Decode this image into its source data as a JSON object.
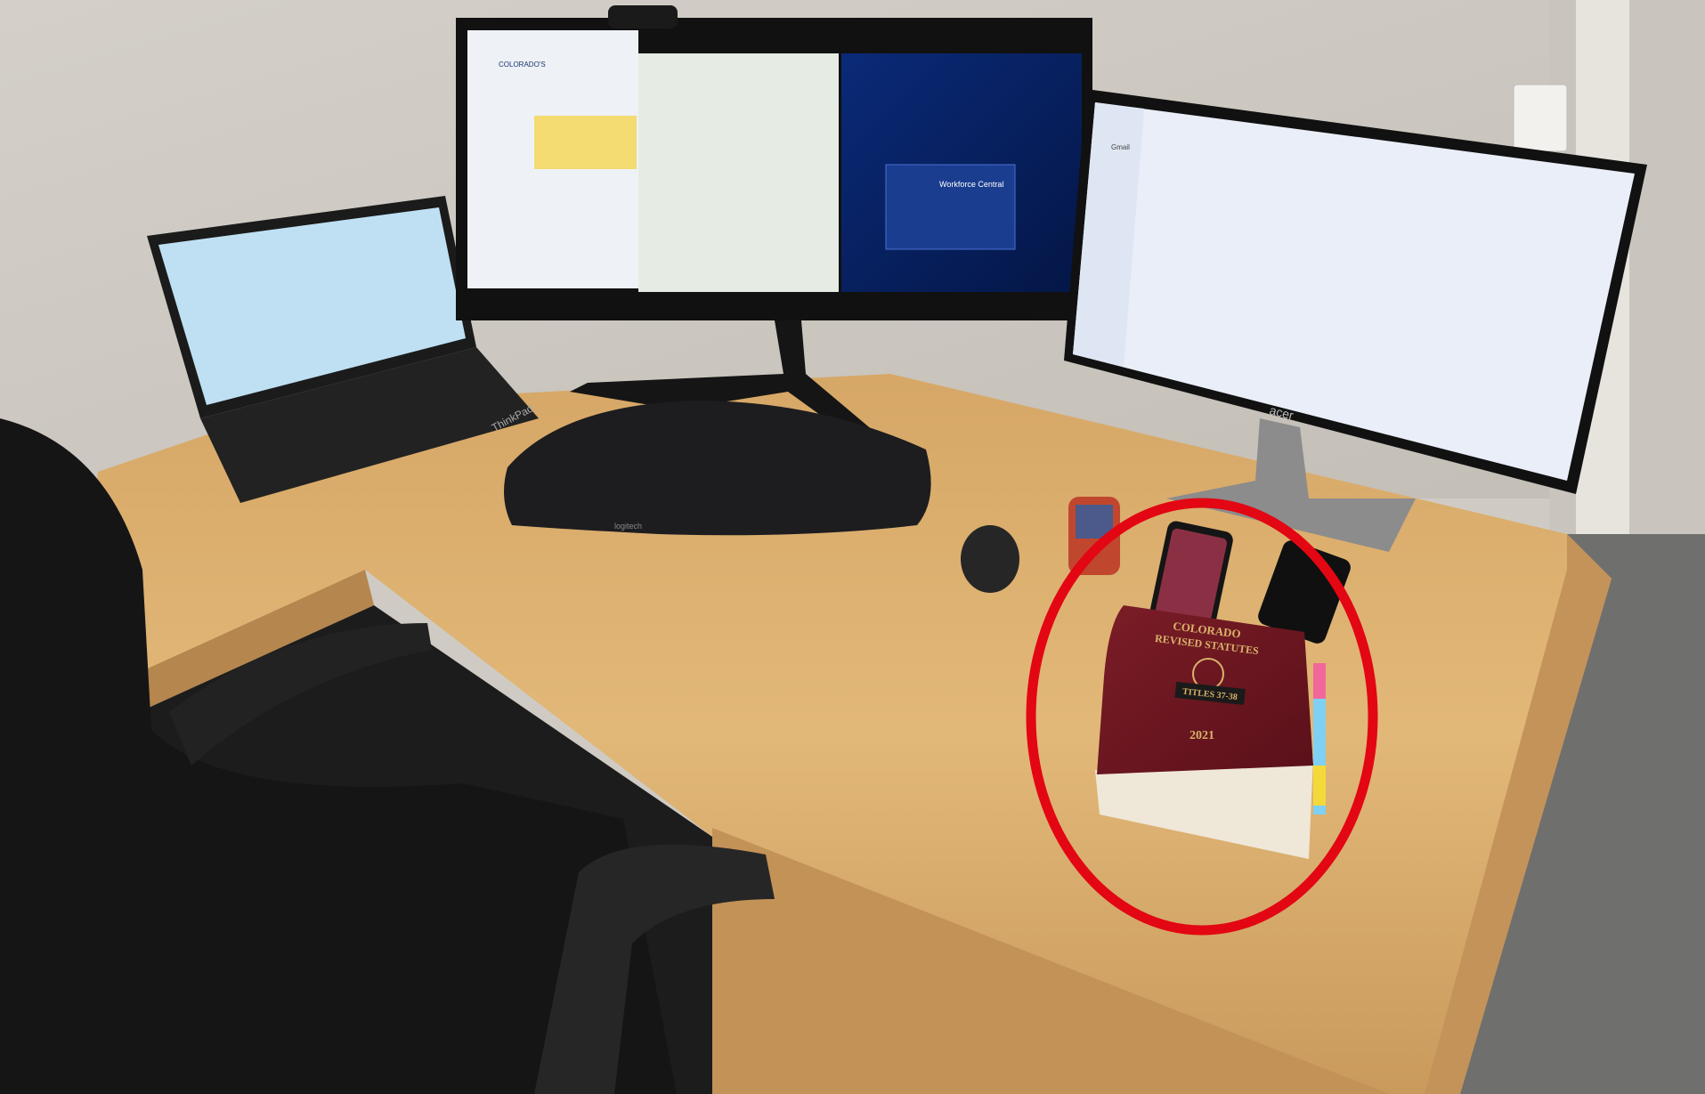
{
  "photo": {
    "laptop_brand": "ThinkPad",
    "keyboard_brand": "logitech",
    "monitor_brand": "acer"
  },
  "screens": {
    "left_monitor_title": "COLORADO'S",
    "workforce_title": "Workforce Central",
    "gmail_label": "Gmail"
  },
  "book": {
    "title_line1": "COLORADO",
    "title_line2": "REVISED STATUTES",
    "volume_label": "TITLES 37-38",
    "year": "2021"
  },
  "annotation": {
    "color": "#e30613"
  }
}
